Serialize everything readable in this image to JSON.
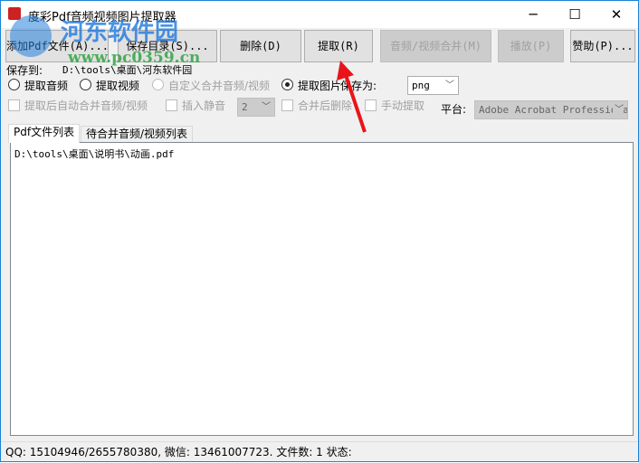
{
  "window": {
    "title": "度彩Pdf音频视频图片提取器",
    "minimize": "─",
    "maximize": "☐",
    "close": "✕"
  },
  "toolbar": {
    "add": "添加Pdf文件(A)...",
    "save_dir": "保存目录(S)...",
    "delete": "删除(D)",
    "extract": "提取(R)",
    "merge": "音频/视频合并(M)",
    "play": "播放(P)",
    "donate": "赞助(P)..."
  },
  "save_to": {
    "label": "保存到:",
    "path": "D:\\tools\\桌面\\河东软件园"
  },
  "options": {
    "extract_audio": "提取音频",
    "extract_video": "提取视频",
    "custom_merge": "自定义合并音频/视频",
    "extract_image": "提取图片",
    "save_as_label": "保存为:",
    "save_as_value": "png",
    "auto_merge": "提取后自动合并音频/视频",
    "insert_silence": "插入静音",
    "silence_value": "2",
    "delete_after_merge": "合并后删除",
    "manual_extract": "手动提取",
    "platform_label": "平台:",
    "platform_value": "Adobe Acrobat Professional"
  },
  "tabs": [
    {
      "label": "Pdf文件列表"
    },
    {
      "label": "待合并音频/视频列表"
    }
  ],
  "files": [
    "D:\\tools\\桌面\\说明书\\动画.pdf"
  ],
  "status": "QQ: 15104946/2655780380, 微信: 13461007723. 文件数: 1  状态:",
  "watermark": {
    "name": "河东软件园",
    "url": "www.pc0359.cn"
  }
}
